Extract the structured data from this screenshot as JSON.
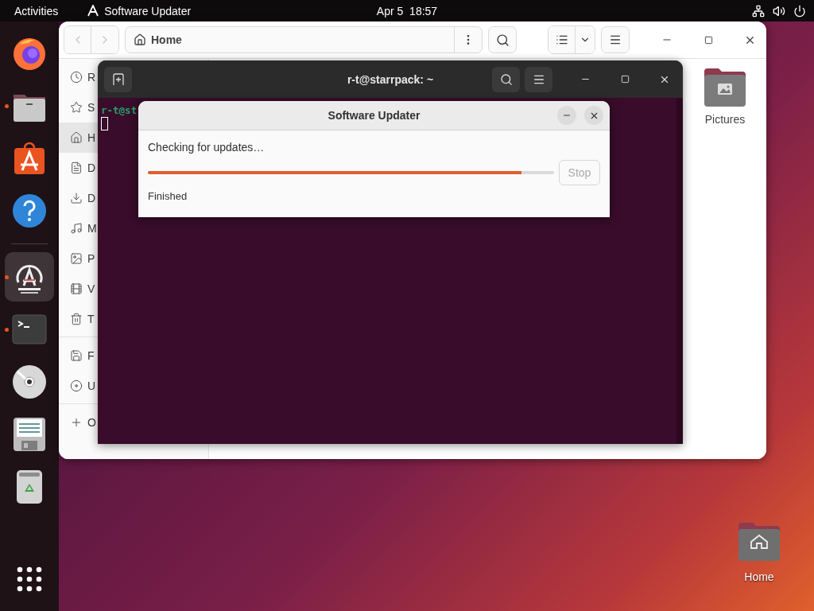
{
  "top_bar": {
    "activities": "Activities",
    "app_name": "Software Updater",
    "clock": "Apr 5  18:57"
  },
  "dock": {
    "items": [
      {
        "kind": "firefox",
        "running": false,
        "selected": false
      },
      {
        "kind": "files",
        "running": true,
        "selected": false
      },
      {
        "kind": "store",
        "running": false,
        "selected": false
      },
      {
        "kind": "help",
        "running": false,
        "selected": false
      },
      {
        "kind": "separator"
      },
      {
        "kind": "updater",
        "running": true,
        "selected": true
      },
      {
        "kind": "terminal",
        "running": true,
        "selected": false
      },
      {
        "kind": "disc",
        "running": false,
        "selected": false
      },
      {
        "kind": "floppy",
        "running": false,
        "selected": false
      },
      {
        "kind": "trash",
        "running": false,
        "selected": false
      }
    ]
  },
  "files_window": {
    "path": "Home",
    "sidebar": [
      {
        "kind": "recent",
        "label": "R",
        "selected": false
      },
      {
        "kind": "starred",
        "label": "S",
        "selected": false
      },
      {
        "kind": "home",
        "label": "H",
        "selected": true
      },
      {
        "kind": "documents",
        "label": "D",
        "selected": false
      },
      {
        "kind": "downloads",
        "label": "D",
        "selected": false
      },
      {
        "kind": "music",
        "label": "M",
        "selected": false
      },
      {
        "kind": "pictures",
        "label": "P",
        "selected": false
      },
      {
        "kind": "videos",
        "label": "V",
        "selected": false
      },
      {
        "kind": "trash",
        "label": "T",
        "selected": false
      },
      {
        "kind": "divider"
      },
      {
        "kind": "floppy",
        "label": "F",
        "selected": false
      },
      {
        "kind": "disc",
        "label": "U",
        "selected": false
      },
      {
        "kind": "divider"
      },
      {
        "kind": "other",
        "label": "O",
        "selected": false
      }
    ],
    "items": [
      {
        "label": "Pictures"
      }
    ]
  },
  "terminal": {
    "title": "r-t@starrpack: ~",
    "prompt": "r-t@st"
  },
  "updater": {
    "title": "Software Updater",
    "status": "Checking for updates…",
    "progress": {
      "level": 0.92
    },
    "stop": {
      "label": "Stop",
      "disabled": true
    },
    "detail": "Finished"
  },
  "desktop_icons": [
    {
      "label": "Home"
    }
  ]
}
